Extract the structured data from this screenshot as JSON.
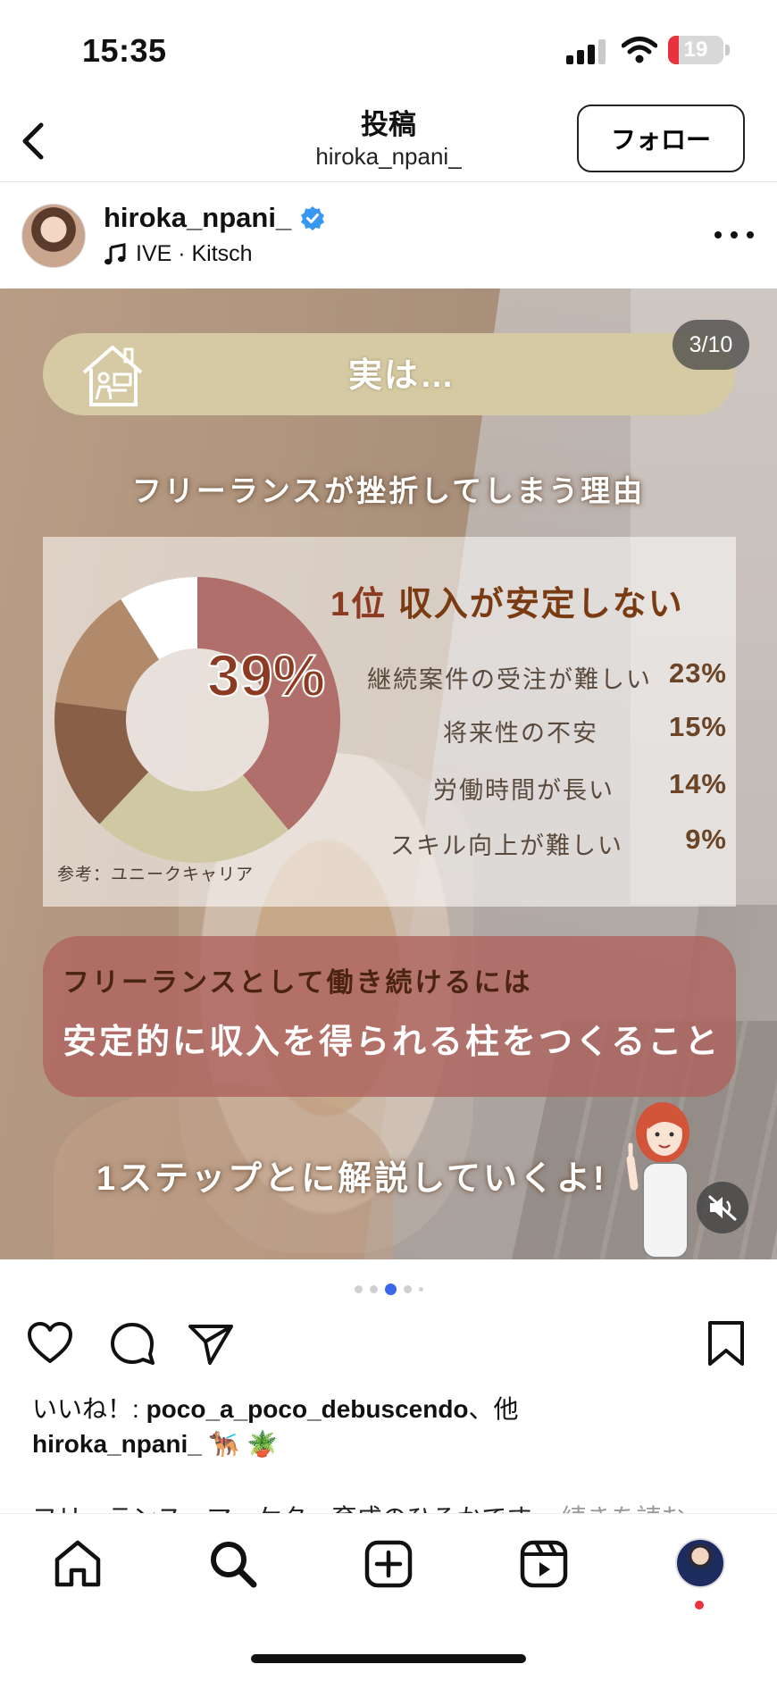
{
  "status_bar": {
    "time": "15:35",
    "battery": "19",
    "battery_level_percent": 19,
    "battery_color": "#e8323c"
  },
  "header": {
    "title": "投稿",
    "subtitle": "hiroka_npani_",
    "follow_label": "フォロー"
  },
  "post": {
    "username": "hiroka_npani_",
    "verified": true,
    "music": "IVE · Kitsch",
    "counter": "3/10",
    "slide": {
      "banner": "実は…",
      "subtitle": "フリーランスが挫折してしまう理由",
      "rank_position": "1位",
      "rank_label": "収入が安定しない",
      "big_percent": "39%",
      "reasons": [
        {
          "label": "継続案件の受注が難しい",
          "value": "23%"
        },
        {
          "label": "将来性の不安",
          "value": "15%"
        },
        {
          "label": "労働時間が長い",
          "value": "14%"
        },
        {
          "label": "スキル向上が難しい",
          "value": "9%"
        }
      ],
      "source": "参考：ユニークキャリア",
      "callout_line1": "フリーランスとして働き続けるには",
      "callout_line2": "安定的に収入を得られる柱をつくること",
      "step_text": "1ステップとに解説していくよ!"
    },
    "chart_colors": [
      "#b06f6a",
      "#cfc8a2",
      "#8a5f47",
      "#b08a6a",
      "#ffffff"
    ],
    "active_dot_color": "#3b66e8"
  },
  "chart_data": {
    "type": "pie",
    "categories": [
      "収入が安定しない",
      "継続案件の受注が難しい",
      "将来性の不安",
      "労働時間が長い",
      "スキル向上が難しい"
    ],
    "values": [
      39,
      23,
      15,
      14,
      9
    ]
  },
  "likes": {
    "prefix": "いいね！: ",
    "user": "poco_a_poco_debuscendo",
    "suffix": "、他"
  },
  "caption": {
    "user": "hiroka_npani_",
    "emoji": "🐕‍🦺 🪴"
  },
  "description": {
    "text": "フリーランス・マーケター育成のひろかです。",
    "more": "続きを読む"
  },
  "icons": {
    "back": "chevron-left-icon",
    "like": "heart-icon",
    "comment": "comment-icon",
    "share": "paper-plane-icon",
    "save": "bookmark-icon",
    "home": "home-icon",
    "search": "search-icon",
    "create": "plus-square-icon",
    "reels": "reels-icon",
    "mute": "speaker-muted-icon"
  }
}
